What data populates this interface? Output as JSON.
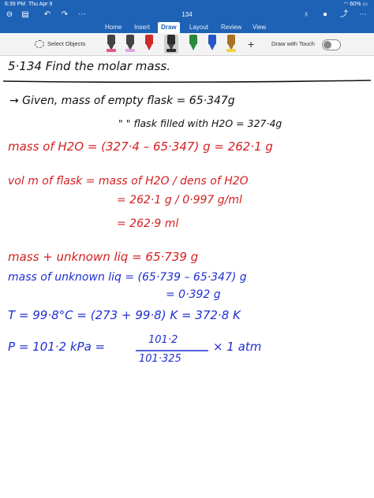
{
  "status_bar": {
    "time": "6:39 PM",
    "date": "Thu Apr 9",
    "battery": "60%"
  },
  "toolbar": {
    "back_icon": "back-arrow-icon",
    "doc_title": "134",
    "tabs": [
      "Home",
      "Insert",
      "Draw",
      "Layout",
      "Review",
      "View"
    ],
    "active_tab": "Draw"
  },
  "ribbon": {
    "select_objects_label": "Select Objects",
    "draw_with_touch_label": "Draw with Touch",
    "pens": [
      {
        "name": "pen-1",
        "color": "#333333",
        "band": "#e05a8a"
      },
      {
        "name": "pen-2",
        "color": "#333333",
        "band": "#d9a6e0"
      },
      {
        "name": "pen-3",
        "color": "#cc2b2b",
        "band": "#f2f2f2"
      },
      {
        "name": "pen-4",
        "color": "#2d2d2d",
        "band": "#2d2d2d"
      },
      {
        "name": "pen-5",
        "color": "#2a8a3b",
        "band": "#2a8a3b"
      },
      {
        "name": "pen-6",
        "color": "#2456c9",
        "band": "#2456c9"
      },
      {
        "name": "pen-7",
        "color": "#a97224",
        "band": "#f1d14a"
      }
    ]
  },
  "notes": {
    "line1": "5·134  Find the molar mass.",
    "line2": "→ Given, mass of empty flask = 65·347g",
    "line3": "\"  \"   flask filled with H2O = 327·4g",
    "line4": "mass of H2O = (327·4 – 65·347) g = 262·1 g",
    "line5": "vol m of flask = mass of H2O / dens of H2O",
    "line6": "= 262·1 g / 0·997 g/ml",
    "line7": "= 262·9 ml",
    "line8": "mass + unknown liq = 65·739 g",
    "line9": "mass of unknown liq = (65·739 – 65·347) g",
    "line10": "= 0·392 g",
    "line11": "T = 99·8°C = (273 + 99·8) K = 372·8 K",
    "line12a": "P = 101·2 kPa =",
    "line12num": "101·2",
    "line12den": "101·325",
    "line12b": "× 1 atm"
  }
}
